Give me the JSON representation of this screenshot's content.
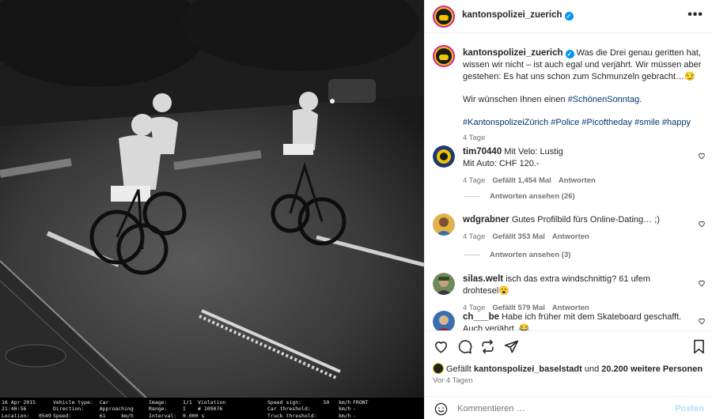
{
  "post": {
    "username": "kantonspolizei_zuerich",
    "verified_mark": "✓",
    "more_label": "•••",
    "caption_line1": "Was die Drei genau geritten hat, wissen wir nicht – ist auch egal und verjährt. Wir müssen aber gestehen: Es hat uns schon zum Schmunzeln gebracht…😏",
    "caption_line2_prefix": "Wir wünschen Ihnen einen ",
    "caption_line2_tag": "#SchönenSonntag",
    "caption_line2_suffix": ".",
    "hashtags": "#KantonspolizeiZürich #Police #Picoftheday #smile #happy",
    "caption_time": "4 Tage"
  },
  "comments": [
    {
      "user": "tim70440",
      "text": "Mit Velo: Lustig\nMit Auto: CHF 120.-",
      "time": "4 Tage",
      "likes": "Gefällt 1,454 Mal",
      "reply": "Antworten",
      "view_replies": "Antworten ansehen (26)"
    },
    {
      "user": "wdgrabner",
      "text": "Gutes Profilbild fürs Online-Dating… ;)",
      "time": "4 Tage",
      "likes": "Gefällt 353 Mal",
      "reply": "Antworten",
      "view_replies": "Antworten ansehen (3)"
    },
    {
      "user": "silas.welt",
      "text": "isch das extra windschnittig? 61 ufem drohtesel😮",
      "time": "4 Tage",
      "likes": "Gefällt 579 Mal",
      "reply": "Antworten"
    },
    {
      "user": "ch___be",
      "text": "Habe ich früher mit dem Skateboard geschafft. Auch verjährt. 😂"
    }
  ],
  "footer": {
    "liked_prefix": "Gefällt ",
    "liked_user": "kantonspolizei_baselstadt",
    "liked_middle": " und ",
    "liked_count": "20.200 weitere Personen",
    "date": "Vor 4 Tagen",
    "comment_placeholder": "Kommentieren …",
    "post_button": "Posten"
  },
  "photo_overlay": {
    "c1": "16 Apr 2015\n21:40:56\nLocation:   0549",
    "c2": "Vehicle type:  Car\nDirection:     Approaching\nSpeed:         61     km/h",
    "c3": "Image:     1/1\nRange:     I\nInterval:  0.000 s",
    "c4": "Violation\n# 109076",
    "c5": "Speed sign:       50   km/h\nCar threshold:         km/h\nTruck threshold:       km/h",
    "c6": "FRONT\n-\n-"
  },
  "colors": {
    "link": "#00376b",
    "verified": "#0095f6",
    "avatar_ring": "#d6249f",
    "avatar_fill": "#f0c400"
  }
}
